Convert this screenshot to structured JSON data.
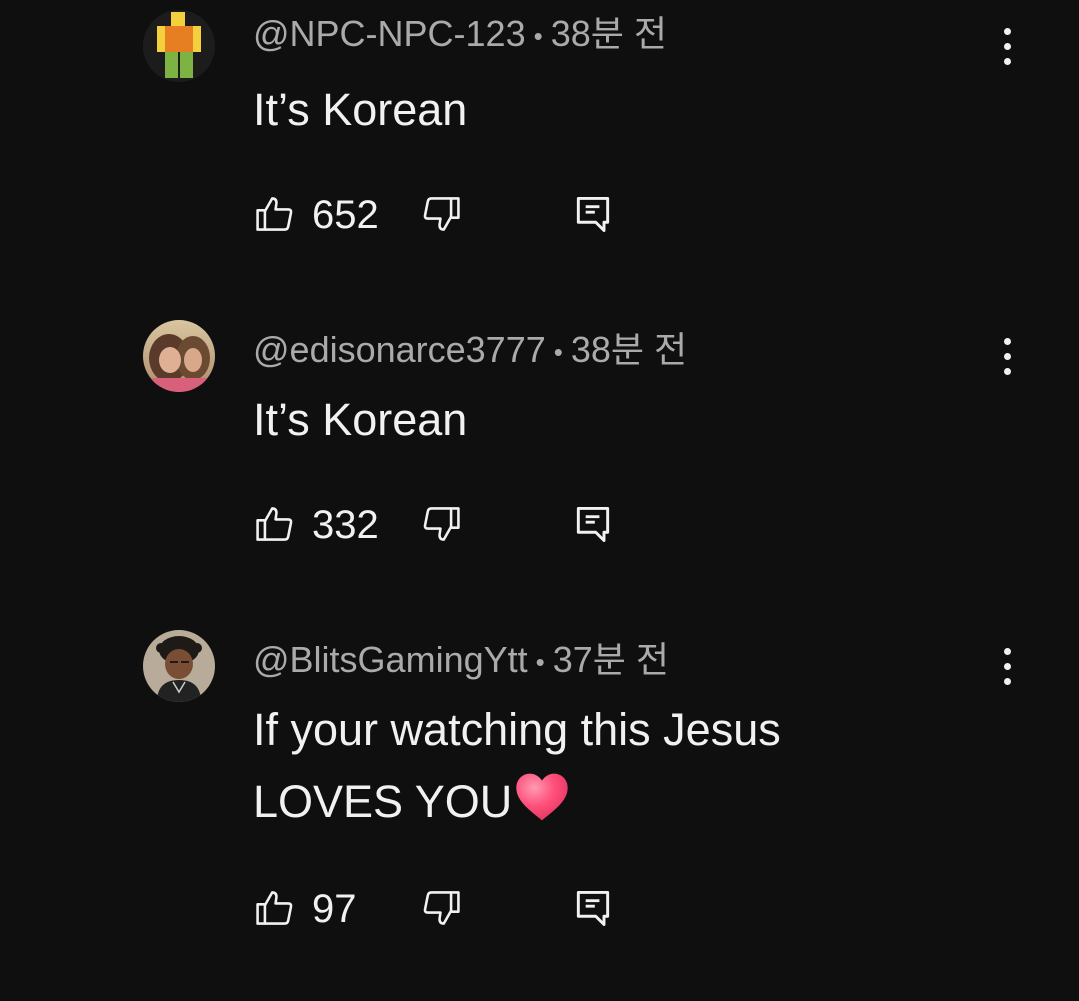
{
  "comments": [
    {
      "author": "@NPC-NPC-123",
      "separator": "•",
      "time": "38분 전",
      "text": "It’s Korean",
      "likes": "652",
      "avatar_icon": "roblox-noob-avatar-icon"
    },
    {
      "author": "@edisonarce3777",
      "separator": "•",
      "time": "38분 전",
      "text": "It’s Korean",
      "likes": "332",
      "avatar_icon": "profile-photo-avatar-icon"
    },
    {
      "author": "@BlitsGamingYtt",
      "separator": "•",
      "time": "37분 전",
      "text_line1": "If your watching this Jesus",
      "text_line2": "LOVES YOU",
      "likes": "97",
      "avatar_icon": "cartoon-avatar-icon"
    }
  ],
  "colors": {
    "background": "#0f0f0f",
    "text": "#f1f1f1",
    "meta": "#aaaaaa",
    "heart": "#ff4f7a"
  },
  "icons": [
    "thumbs-up-icon",
    "thumbs-down-icon",
    "reply-icon",
    "more-vert-icon",
    "heart-emoji-icon"
  ]
}
